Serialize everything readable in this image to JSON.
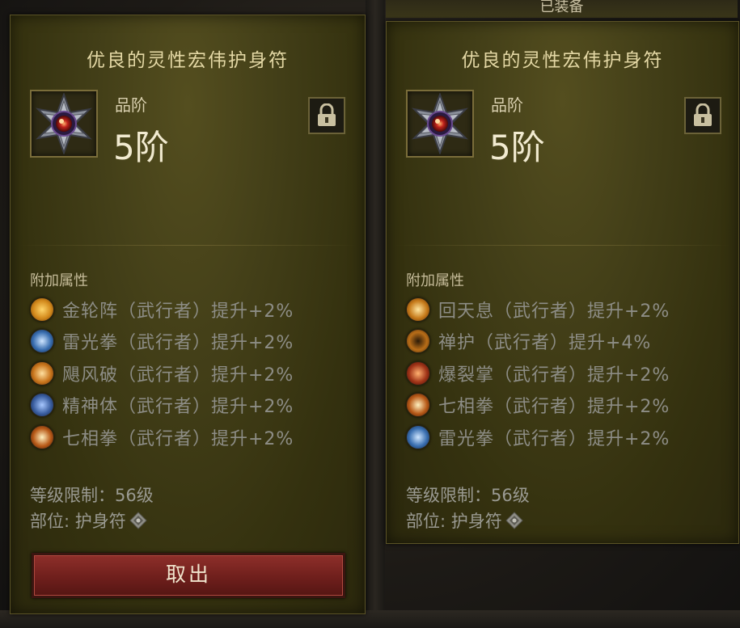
{
  "equipped_label": "已装备",
  "left_item": {
    "title": "优良的灵性宏伟护身符",
    "quality_label": "品阶",
    "quality_value": "5阶",
    "affix_header": "附加属性",
    "affixes": [
      {
        "text": "金轮阵（武行者）提升+2%",
        "icon": "golden-wheel-icon",
        "color": "#d38a1c"
      },
      {
        "text": "雷光拳（武行者）提升+2%",
        "icon": "thunder-fist-icon",
        "color": "#3a6fb0"
      },
      {
        "text": "飓风破（武行者）提升+2%",
        "icon": "cyclone-strike-icon",
        "color": "#c9751c"
      },
      {
        "text": "精神体（武行者）提升+2%",
        "icon": "spirit-body-icon",
        "color": "#3b5fa0"
      },
      {
        "text": "七相拳（武行者）提升+2%",
        "icon": "seven-sided-strike-icon",
        "color": "#b85a18"
      }
    ],
    "level_req": "等级限制：56级",
    "slot": "部位: 护身符",
    "take_out_button": "取出"
  },
  "right_item": {
    "title": "优良的灵性宏伟护身符",
    "quality_label": "品阶",
    "quality_value": "5阶",
    "affix_header": "附加属性",
    "affixes": [
      {
        "text": "回天息（武行者）提升+2%",
        "icon": "breath-of-heaven-icon",
        "color": "#c67a1a"
      },
      {
        "text": "禅护（武行者）提升+4%",
        "icon": "serenity-icon",
        "color": "#b86d18"
      },
      {
        "text": "爆裂掌（武行者）提升+2%",
        "icon": "exploding-palm-icon",
        "color": "#a03418"
      },
      {
        "text": "七相拳（武行者）提升+2%",
        "icon": "seven-sided-strike-icon",
        "color": "#b85a18"
      },
      {
        "text": "雷光拳（武行者）提升+2%",
        "icon": "thunder-fist-icon",
        "color": "#3a6fb0"
      }
    ],
    "level_req": "等级限制：56级",
    "slot": "部位: 护身符"
  }
}
